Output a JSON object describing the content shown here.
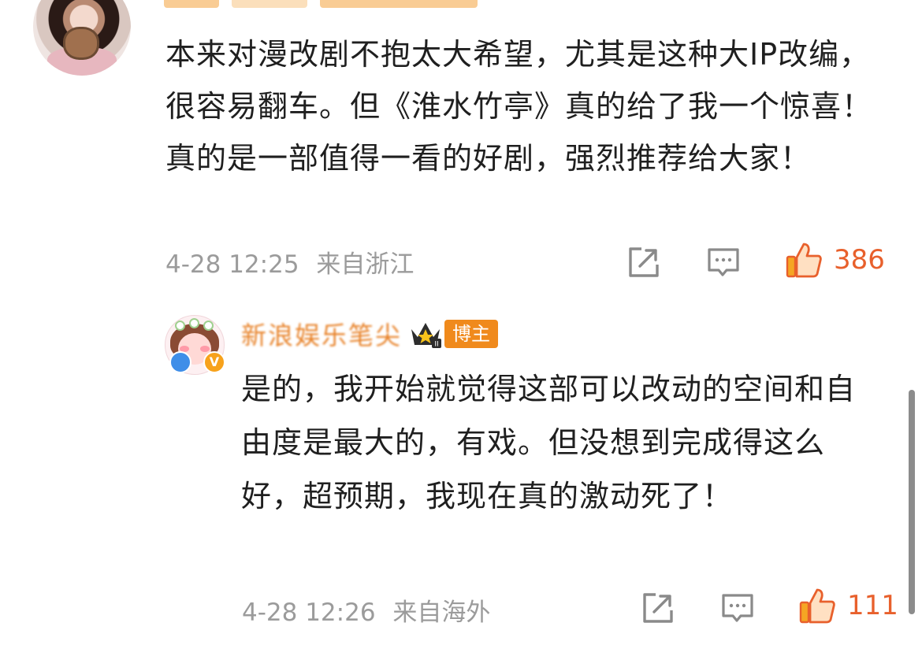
{
  "main_comment": {
    "text": "本来对漫改剧不抱太大希望，尤其是这种大IP改编，很容易翻车。但《淮水竹亭》真的给了我一个惊喜！真的是一部值得一看的好剧，强烈推荐给大家！",
    "timestamp": "4-28 12:25",
    "location": "来自浙江",
    "like_count": "386"
  },
  "reply": {
    "username": "新浪娱乐笔尖",
    "role_tag": "博主",
    "verified_badge": "V",
    "text": "是的，我开始就觉得这部可以改动的空间和自由度是最大的，有戏。但没想到完成得这么好，超预期，我现在真的激动死了！",
    "timestamp": "4-28 12:26",
    "location": "来自海外",
    "like_count": "111"
  },
  "colors": {
    "accent": "#e8602c",
    "username": "#e8842c",
    "tag_bg": "#f08a1c",
    "meta_gray": "#9b9b9b"
  },
  "icons": {
    "share": "share-icon",
    "comment": "comment-icon",
    "like": "thumbs-up-icon"
  }
}
